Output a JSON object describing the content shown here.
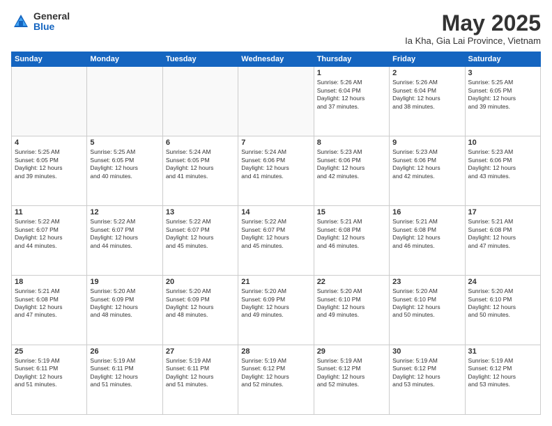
{
  "logo": {
    "general": "General",
    "blue": "Blue"
  },
  "title": "May 2025",
  "subtitle": "Ia Kha, Gia Lai Province, Vietnam",
  "headers": [
    "Sunday",
    "Monday",
    "Tuesday",
    "Wednesday",
    "Thursday",
    "Friday",
    "Saturday"
  ],
  "weeks": [
    [
      {
        "day": "",
        "info": ""
      },
      {
        "day": "",
        "info": ""
      },
      {
        "day": "",
        "info": ""
      },
      {
        "day": "",
        "info": ""
      },
      {
        "day": "1",
        "info": "Sunrise: 5:26 AM\nSunset: 6:04 PM\nDaylight: 12 hours\nand 37 minutes."
      },
      {
        "day": "2",
        "info": "Sunrise: 5:26 AM\nSunset: 6:04 PM\nDaylight: 12 hours\nand 38 minutes."
      },
      {
        "day": "3",
        "info": "Sunrise: 5:25 AM\nSunset: 6:05 PM\nDaylight: 12 hours\nand 39 minutes."
      }
    ],
    [
      {
        "day": "4",
        "info": "Sunrise: 5:25 AM\nSunset: 6:05 PM\nDaylight: 12 hours\nand 39 minutes."
      },
      {
        "day": "5",
        "info": "Sunrise: 5:25 AM\nSunset: 6:05 PM\nDaylight: 12 hours\nand 40 minutes."
      },
      {
        "day": "6",
        "info": "Sunrise: 5:24 AM\nSunset: 6:05 PM\nDaylight: 12 hours\nand 41 minutes."
      },
      {
        "day": "7",
        "info": "Sunrise: 5:24 AM\nSunset: 6:06 PM\nDaylight: 12 hours\nand 41 minutes."
      },
      {
        "day": "8",
        "info": "Sunrise: 5:23 AM\nSunset: 6:06 PM\nDaylight: 12 hours\nand 42 minutes."
      },
      {
        "day": "9",
        "info": "Sunrise: 5:23 AM\nSunset: 6:06 PM\nDaylight: 12 hours\nand 42 minutes."
      },
      {
        "day": "10",
        "info": "Sunrise: 5:23 AM\nSunset: 6:06 PM\nDaylight: 12 hours\nand 43 minutes."
      }
    ],
    [
      {
        "day": "11",
        "info": "Sunrise: 5:22 AM\nSunset: 6:07 PM\nDaylight: 12 hours\nand 44 minutes."
      },
      {
        "day": "12",
        "info": "Sunrise: 5:22 AM\nSunset: 6:07 PM\nDaylight: 12 hours\nand 44 minutes."
      },
      {
        "day": "13",
        "info": "Sunrise: 5:22 AM\nSunset: 6:07 PM\nDaylight: 12 hours\nand 45 minutes."
      },
      {
        "day": "14",
        "info": "Sunrise: 5:22 AM\nSunset: 6:07 PM\nDaylight: 12 hours\nand 45 minutes."
      },
      {
        "day": "15",
        "info": "Sunrise: 5:21 AM\nSunset: 6:08 PM\nDaylight: 12 hours\nand 46 minutes."
      },
      {
        "day": "16",
        "info": "Sunrise: 5:21 AM\nSunset: 6:08 PM\nDaylight: 12 hours\nand 46 minutes."
      },
      {
        "day": "17",
        "info": "Sunrise: 5:21 AM\nSunset: 6:08 PM\nDaylight: 12 hours\nand 47 minutes."
      }
    ],
    [
      {
        "day": "18",
        "info": "Sunrise: 5:21 AM\nSunset: 6:08 PM\nDaylight: 12 hours\nand 47 minutes."
      },
      {
        "day": "19",
        "info": "Sunrise: 5:20 AM\nSunset: 6:09 PM\nDaylight: 12 hours\nand 48 minutes."
      },
      {
        "day": "20",
        "info": "Sunrise: 5:20 AM\nSunset: 6:09 PM\nDaylight: 12 hours\nand 48 minutes."
      },
      {
        "day": "21",
        "info": "Sunrise: 5:20 AM\nSunset: 6:09 PM\nDaylight: 12 hours\nand 49 minutes."
      },
      {
        "day": "22",
        "info": "Sunrise: 5:20 AM\nSunset: 6:10 PM\nDaylight: 12 hours\nand 49 minutes."
      },
      {
        "day": "23",
        "info": "Sunrise: 5:20 AM\nSunset: 6:10 PM\nDaylight: 12 hours\nand 50 minutes."
      },
      {
        "day": "24",
        "info": "Sunrise: 5:20 AM\nSunset: 6:10 PM\nDaylight: 12 hours\nand 50 minutes."
      }
    ],
    [
      {
        "day": "25",
        "info": "Sunrise: 5:19 AM\nSunset: 6:11 PM\nDaylight: 12 hours\nand 51 minutes."
      },
      {
        "day": "26",
        "info": "Sunrise: 5:19 AM\nSunset: 6:11 PM\nDaylight: 12 hours\nand 51 minutes."
      },
      {
        "day": "27",
        "info": "Sunrise: 5:19 AM\nSunset: 6:11 PM\nDaylight: 12 hours\nand 51 minutes."
      },
      {
        "day": "28",
        "info": "Sunrise: 5:19 AM\nSunset: 6:12 PM\nDaylight: 12 hours\nand 52 minutes."
      },
      {
        "day": "29",
        "info": "Sunrise: 5:19 AM\nSunset: 6:12 PM\nDaylight: 12 hours\nand 52 minutes."
      },
      {
        "day": "30",
        "info": "Sunrise: 5:19 AM\nSunset: 6:12 PM\nDaylight: 12 hours\nand 53 minutes."
      },
      {
        "day": "31",
        "info": "Sunrise: 5:19 AM\nSunset: 6:12 PM\nDaylight: 12 hours\nand 53 minutes."
      }
    ]
  ]
}
